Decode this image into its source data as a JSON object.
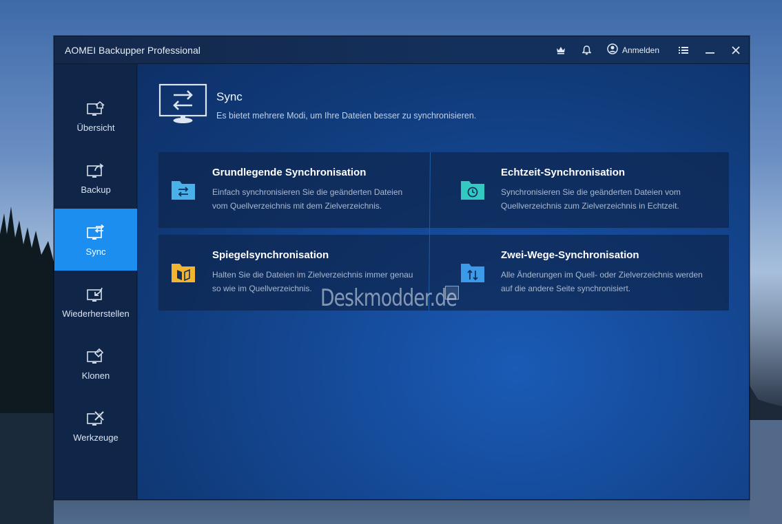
{
  "window": {
    "title": "AOMEI Backupper Professional",
    "login_label": "Anmelden"
  },
  "titlebar_icons": [
    "crown-icon",
    "bell-icon",
    "user-icon",
    "menu-icon",
    "minimize-icon",
    "close-icon"
  ],
  "sidebar": {
    "items": [
      {
        "label": "Übersicht",
        "icon": "monitor-home-icon",
        "active": false
      },
      {
        "label": "Backup",
        "icon": "monitor-backup-icon",
        "active": false
      },
      {
        "label": "Sync",
        "icon": "monitor-sync-icon",
        "active": true
      },
      {
        "label": "Wiederherstellen",
        "icon": "monitor-restore-icon",
        "active": false
      },
      {
        "label": "Klonen",
        "icon": "monitor-clone-icon",
        "active": false
      },
      {
        "label": "Werkzeuge",
        "icon": "monitor-tools-icon",
        "active": false
      }
    ]
  },
  "main": {
    "title": "Sync",
    "description": "Es bietet mehrere Modi, um Ihre Dateien besser zu synchronisieren.",
    "cards": [
      {
        "title": "Grundlegende Synchronisation",
        "desc_line1": "Einfach synchronisieren Sie die geänderten Dateien",
        "desc_line2": "vom Quellverzeichnis mit dem Zielverzeichnis.",
        "icon": "folder-sync-icon",
        "color": "#4ab0e8"
      },
      {
        "title": "Echtzeit-Synchronisation",
        "desc_line1": "Synchronisieren Sie die geänderten Dateien vom",
        "desc_line2": "Quellverzeichnis zum Zielverzeichnis in Echtzeit.",
        "icon": "folder-clock-icon",
        "color": "#33c9c0"
      },
      {
        "title": "Spiegelsynchronisation",
        "desc_line1": "Halten Sie die Dateien im Zielverzeichnis immer genau",
        "desc_line2": "so wie im Quellverzeichnis.",
        "icon": "folder-mirror-icon",
        "color": "#f2b431"
      },
      {
        "title": "Zwei-Wege-Synchronisation",
        "desc_line1": "Alle Änderungen im Quell- oder Zielverzeichnis werden",
        "desc_line2": "auf die andere Seite synchronisiert.",
        "icon": "folder-two-way-icon",
        "color": "#3d9ae8"
      }
    ]
  },
  "watermark": "Deskmodder.de",
  "colors": {
    "accent": "#1b8ef0",
    "sidebar_bg": "#0f2648",
    "titlebar_bg": "#14284a"
  }
}
